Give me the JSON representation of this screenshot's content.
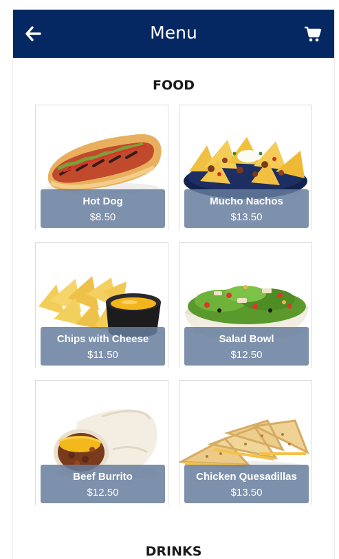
{
  "header": {
    "title": "Menu",
    "back_icon": "arrow-left-icon",
    "cart_icon": "shopping-cart-icon",
    "background": "#062862"
  },
  "sections": [
    {
      "title": "FOOD",
      "items": [
        {
          "name": "Hot Dog",
          "price": "$8.50",
          "image": "hot-dog"
        },
        {
          "name": "Mucho Nachos",
          "price": "$13.50",
          "image": "nachos"
        },
        {
          "name": "Chips with Cheese",
          "price": "$11.50",
          "image": "chips-cheese"
        },
        {
          "name": "Salad Bowl",
          "price": "$12.50",
          "image": "salad-bowl"
        },
        {
          "name": "Beef Burrito",
          "price": "$12.50",
          "image": "burrito"
        },
        {
          "name": "Chicken Quesadillas",
          "price": "$13.50",
          "image": "quesadillas"
        }
      ]
    },
    {
      "title": "DRINKS",
      "items": []
    }
  ],
  "colors": {
    "label_overlay": "#667c9e",
    "header_text": "#ffffff"
  }
}
